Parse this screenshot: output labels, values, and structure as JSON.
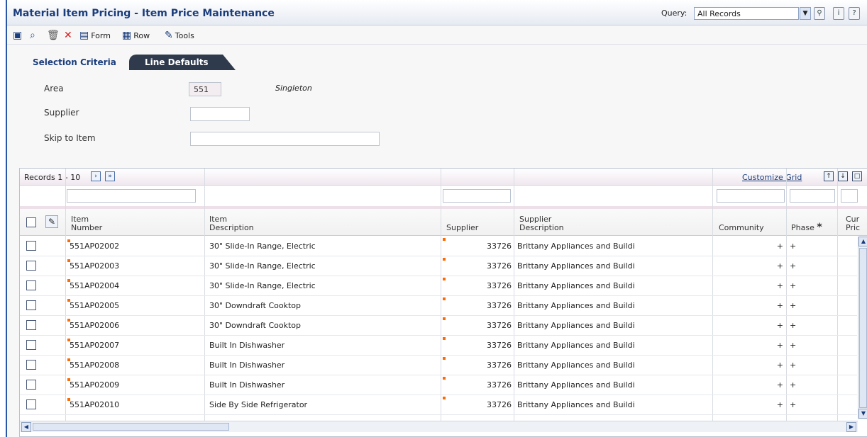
{
  "header": {
    "title": "Material Item Pricing - Item Price Maintenance",
    "query_label": "Query:",
    "query_value": "All Records"
  },
  "toolbar": {
    "form": "Form",
    "row": "Row",
    "tools": "Tools"
  },
  "tabs": {
    "selection": "Selection Criteria",
    "line_defaults": "Line Defaults"
  },
  "form": {
    "area_label": "Area",
    "area_value": "551",
    "area_desc": "Singleton",
    "supplier_label": "Supplier",
    "supplier_value": "",
    "skip_label": "Skip to Item",
    "skip_value": ""
  },
  "grid": {
    "records": "Records 1 - 10",
    "customize": "Customize Grid",
    "headers": {
      "item_number_1": "Item",
      "item_number_2": "Number",
      "item_desc_1": "Item",
      "item_desc_2": "Description",
      "supplier": "Supplier",
      "supplier_desc_1": "Supplier",
      "supplier_desc_2": "Description",
      "community": "Community",
      "phase": "Phase",
      "cur_1": "Cur",
      "cur_2": "Pric"
    },
    "rows": [
      {
        "item": "551AP02002",
        "desc": "30\" Slide-In Range, Electric",
        "supplier": "33726",
        "supplier_desc": "Brittany Appliances and Buildi",
        "community": "+",
        "phase": "+"
      },
      {
        "item": "551AP02003",
        "desc": "30\" Slide-In Range, Electric",
        "supplier": "33726",
        "supplier_desc": "Brittany Appliances and Buildi",
        "community": "+",
        "phase": "+"
      },
      {
        "item": "551AP02004",
        "desc": "30\" Slide-In Range, Electric",
        "supplier": "33726",
        "supplier_desc": "Brittany Appliances and Buildi",
        "community": "+",
        "phase": "+"
      },
      {
        "item": "551AP02005",
        "desc": "30\" Downdraft Cooktop",
        "supplier": "33726",
        "supplier_desc": "Brittany Appliances and Buildi",
        "community": "+",
        "phase": "+"
      },
      {
        "item": "551AP02006",
        "desc": "30\" Downdraft Cooktop",
        "supplier": "33726",
        "supplier_desc": "Brittany Appliances and Buildi",
        "community": "+",
        "phase": "+"
      },
      {
        "item": "551AP02007",
        "desc": "Built In Dishwasher",
        "supplier": "33726",
        "supplier_desc": "Brittany Appliances and Buildi",
        "community": "+",
        "phase": "+"
      },
      {
        "item": "551AP02008",
        "desc": "Built In Dishwasher",
        "supplier": "33726",
        "supplier_desc": "Brittany Appliances and Buildi",
        "community": "+",
        "phase": "+"
      },
      {
        "item": "551AP02009",
        "desc": "Built In Dishwasher",
        "supplier": "33726",
        "supplier_desc": "Brittany Appliances and Buildi",
        "community": "+",
        "phase": "+"
      },
      {
        "item": "551AP02010",
        "desc": "Side By Side Refrigerator",
        "supplier": "33726",
        "supplier_desc": "Brittany Appliances and Buildi",
        "community": "+",
        "phase": "+"
      }
    ]
  },
  "colors": {
    "accent": "#1a3d7c",
    "required": "#ff6a00",
    "tab_dark": "#2f3b4d"
  }
}
